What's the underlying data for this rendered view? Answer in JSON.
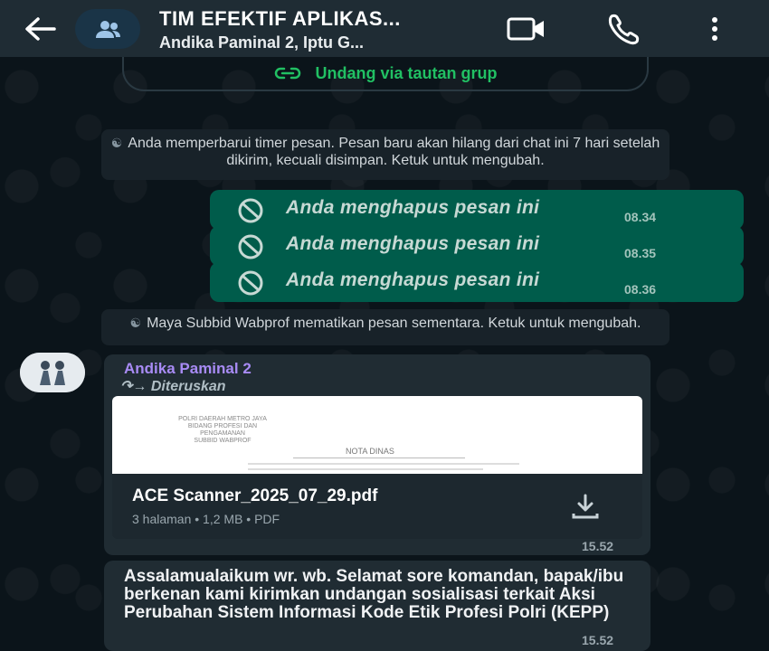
{
  "header": {
    "title": "TIM EFEKTIF APLIKAS...",
    "subtitle": "Andika Paminal 2, Iptu G..."
  },
  "invite": {
    "label": "Undang via tautan grup"
  },
  "system_messages": {
    "timer": "Anda memperbarui timer pesan. Pesan baru akan hilang dari chat ini 7 hari setelah dikirim, kecuali disimpan. Ketuk untuk mengubah.",
    "disappearing_off": "Maya Subbid Wabprof mematikan pesan sementara. Ketuk untuk mengubah."
  },
  "deleted_messages": [
    {
      "text": "Anda menghapus pesan ini",
      "time": "08.34"
    },
    {
      "text": "Anda menghapus pesan ini",
      "time": "08.35"
    },
    {
      "text": "Anda menghapus pesan ini",
      "time": "08.36"
    }
  ],
  "doc_message": {
    "sender": "Andika Paminal 2",
    "forwarded": "Diteruskan",
    "preview_lines": [
      "POLRI DAERAH METRO JAYA",
      "BIDANG PROFESI DAN PENGAMANAN",
      "SUBBID WABPROF",
      "NOTA DINAS"
    ],
    "filename": "ACE Scanner_2025_07_29.pdf",
    "meta": "3 halaman • 1,2 MB • PDF",
    "time": "15.52"
  },
  "text_message": {
    "text": "Assalamualaikum wr. wb. Selamat sore komandan, bapak/ibu berkenan kami kirimkan undangan sosialisasi terkait Aksi Perubahan Sistem Informasi Kode Etik Profesi Polri (KEPP)",
    "time": "15.52"
  },
  "colors": {
    "header_bg": "#1f2c34",
    "outgoing_bubble": "#005c4b",
    "incoming_bubble": "#202c33",
    "accent_green": "#21c063",
    "sender_purple": "#a88bf5"
  }
}
